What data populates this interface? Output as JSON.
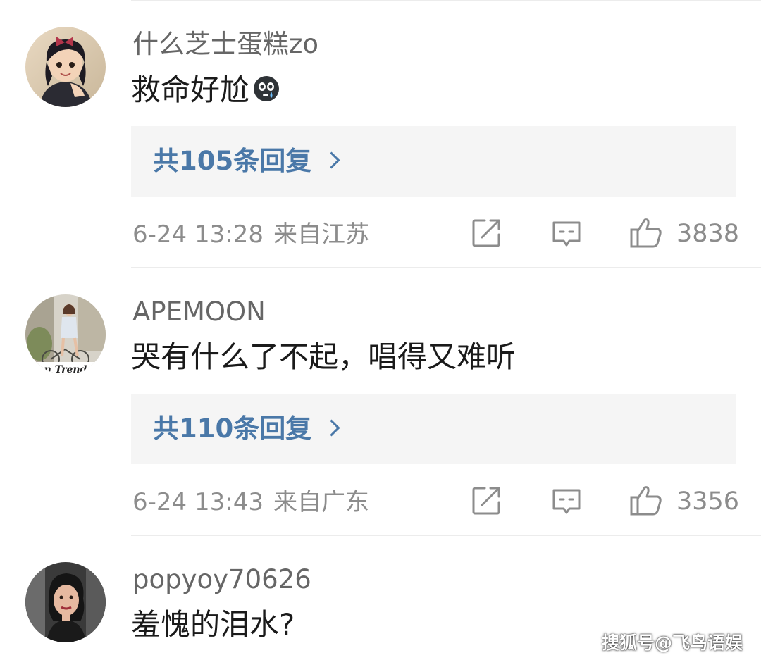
{
  "comments": [
    {
      "username": "什么芝士蛋糕zo",
      "text": "救命好尬",
      "emoji": "crying-face-emoji",
      "replies_label": "共105条回复",
      "time": "6-24 13:28",
      "location": "来自江苏",
      "likes": "3838"
    },
    {
      "username": "APEMOON",
      "text": "哭有什么了不起，唱得又难听",
      "avatar_caption": "n Trend",
      "replies_label": "共110条回复",
      "time": "6-24 13:43",
      "location": "来自广东",
      "likes": "3356"
    },
    {
      "username": "popyoy70626",
      "text": "羞愧的泪水?"
    }
  ],
  "icons": {
    "share": "share-icon",
    "comment": "comment-icon",
    "like": "thumbs-up-icon"
  },
  "colors": {
    "reply_link": "#4a78a8",
    "reply_bg": "#f5f5f5",
    "meta_text": "#8c8c8c",
    "username": "#666666",
    "content": "#1a1a1a"
  },
  "watermark": "搜狐号@飞鸟语娱"
}
